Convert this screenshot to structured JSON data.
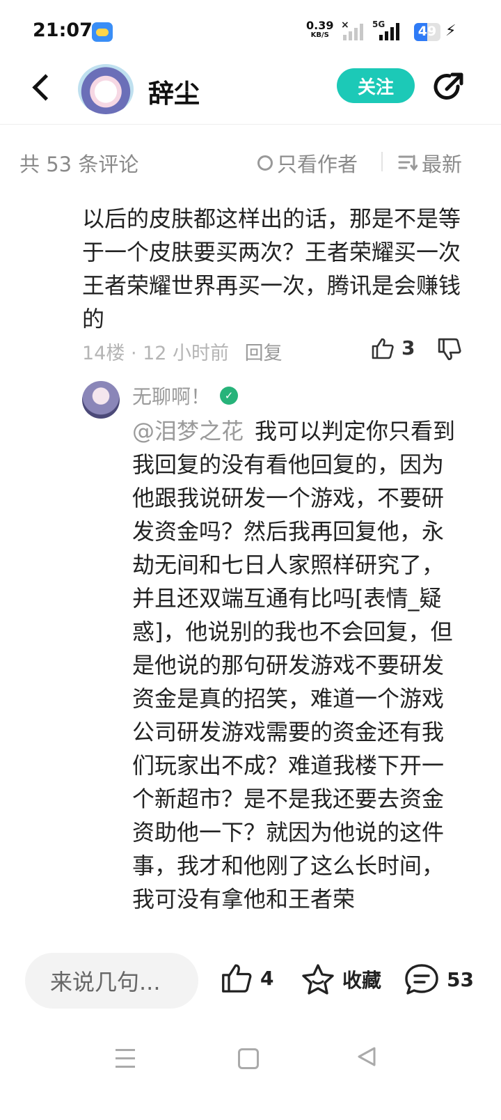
{
  "status_bar": {
    "time": "21:07",
    "net_speed_value": "0.39",
    "net_speed_unit": "KB/S",
    "network": "5G",
    "battery": "49",
    "battery_level_percent": 49
  },
  "header": {
    "title": "辞尘",
    "follow_label": "关注"
  },
  "filter_bar": {
    "count_label": "共 53 条评论",
    "only_author_label": "只看作者",
    "sort_label": "最新"
  },
  "comment_partial": {
    "text": "以后的皮肤都这样出的话，那是不是等于一个皮肤要买两次？王者荣耀买一次王者荣耀世界再买一次，腾讯是会赚钱的",
    "floor_time": "14楼 · 12 小时前",
    "reply_label": "回复",
    "like_count": "3"
  },
  "reply": {
    "username": "无聊啊！",
    "mention": "@泪梦之花",
    "text": "我可以判定你只看到我回复的没有看他回复的，因为他跟我说研发一个游戏，不要研发资金吗？然后我再回复他，永劫无间和七日人家照样研究了，并且还双端互通有比吗[表情_疑惑]，他说别的我也不会回复，但是他说的那句研发游戏不要研发资金是真的招笑，难道一个游戏公司研发游戏需要的资金还有我们玩家出不成？难道我楼下开一个新超市？是不是我还要去资金资助他一下？就因为他说的这件事，我才和他刚了这么长时间，我可没有拿他和王者荣"
  },
  "bottom_bar": {
    "input_placeholder": "来说几句...",
    "like_count": "4",
    "favorite_label": "收藏",
    "comment_count": "53"
  },
  "colors": {
    "accent": "#1cc9b7",
    "muted_text": "#8a8a8a",
    "battery": "#2f7bf6"
  }
}
